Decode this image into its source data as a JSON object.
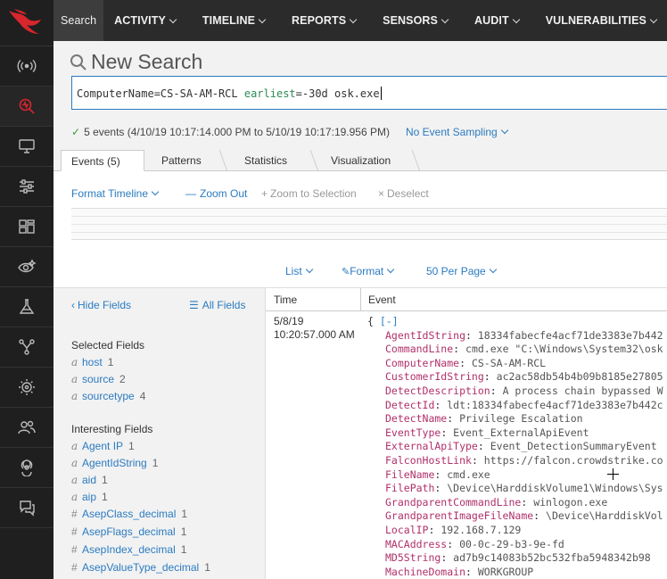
{
  "nav": {
    "items": [
      {
        "label": "Search",
        "dropdown": false
      },
      {
        "label": "ACTIVITY",
        "dropdown": true
      },
      {
        "label": "TIMELINE",
        "dropdown": true
      },
      {
        "label": "REPORTS",
        "dropdown": true
      },
      {
        "label": "SENSORS",
        "dropdown": true
      },
      {
        "label": "AUDIT",
        "dropdown": true
      },
      {
        "label": "VULNERABILITIES",
        "dropdown": true
      }
    ]
  },
  "rail": {
    "icons": [
      "falcon-logo-icon",
      "broadcast-icon",
      "search-activity-icon",
      "monitor-icon",
      "sliders-icon",
      "dashboard-icon",
      "eye-sparkle-icon",
      "flask-icon",
      "network-graph-icon",
      "target-icon",
      "users-icon",
      "biohazard-icon",
      "chat-icon"
    ]
  },
  "header": {
    "title": "New Search",
    "query": {
      "prefix": "ComputerName=CS-SA-AM-RCL ",
      "keyword": "earliest",
      "suffix": "=-30d osk.exe"
    },
    "status_text": "5 events (4/10/19 10:17:14.000 PM to 5/10/19 10:17:19.956 PM)",
    "sampling_label": "No Event Sampling"
  },
  "tabs": [
    "Events (5)",
    "Patterns",
    "Statistics",
    "Visualization"
  ],
  "timeline_toolbar": {
    "format_timeline": "Format Timeline",
    "zoom_out": "Zoom Out",
    "zoom_to_selection": "Zoom to Selection",
    "deselect": "Deselect"
  },
  "list_toolbar": {
    "list": "List",
    "format": "Format",
    "per_page": "50 Per Page"
  },
  "fields": {
    "hide_fields": "Hide Fields",
    "all_fields": "All Fields",
    "selected_heading": "Selected Fields",
    "selected": [
      {
        "type": "a",
        "name": "host",
        "count": "1"
      },
      {
        "type": "a",
        "name": "source",
        "count": "2"
      },
      {
        "type": "a",
        "name": "sourcetype",
        "count": "4"
      }
    ],
    "interesting_heading": "Interesting Fields",
    "interesting": [
      {
        "type": "a",
        "name": "Agent IP",
        "count": "1"
      },
      {
        "type": "a",
        "name": "AgentIdString",
        "count": "1"
      },
      {
        "type": "a",
        "name": "aid",
        "count": "1"
      },
      {
        "type": "a",
        "name": "aip",
        "count": "1"
      },
      {
        "type": "#",
        "name": "AsepClass_decimal",
        "count": "1"
      },
      {
        "type": "#",
        "name": "AsepFlags_decimal",
        "count": "1"
      },
      {
        "type": "#",
        "name": "AsepIndex_decimal",
        "count": "1"
      },
      {
        "type": "#",
        "name": "AsepValueType_decimal",
        "count": "1"
      }
    ]
  },
  "events": {
    "col_time": "Time",
    "col_event": "Event",
    "time_date": "5/8/19",
    "time_clock": "10:20:57.000 AM",
    "open_brace": "{",
    "collapse": "[-]",
    "kv": [
      {
        "k": "AgentIdString",
        "v": "18334fabecfe4acf71de3383e7b442"
      },
      {
        "k": "CommandLine",
        "v": "cmd.exe \"C:\\Windows\\System32\\osk"
      },
      {
        "k": "ComputerName",
        "v": "CS-SA-AM-RCL"
      },
      {
        "k": "CustomerIdString",
        "v": "ac2ac58db54b4b09b8185e27805"
      },
      {
        "k": "DetectDescription",
        "v": "A process chain bypassed W"
      },
      {
        "k": "DetectId",
        "v": "ldt:18334fabecfe4acf71de3383e7b442c"
      },
      {
        "k": "DetectName",
        "v": "Privilege Escalation"
      },
      {
        "k": "EventType",
        "v": "Event_ExternalApiEvent"
      },
      {
        "k": "ExternalApiType",
        "v": "Event_DetectionSummaryEvent"
      },
      {
        "k": "FalconHostLink",
        "v": "https://falcon.crowdstrike.co"
      },
      {
        "k": "FileName",
        "v": "cmd.exe"
      },
      {
        "k": "FilePath",
        "v": "\\Device\\HarddiskVolume1\\Windows\\Sys"
      },
      {
        "k": "GrandparentCommandLine",
        "v": "winlogon.exe"
      },
      {
        "k": "GrandparentImageFileName",
        "v": "\\Device\\HarddiskVol"
      },
      {
        "k": "LocalIP",
        "v": "192.168.7.129"
      },
      {
        "k": "MACAddress",
        "v": "00-0c-29-b3-9e-fd"
      },
      {
        "k": "MD5String",
        "v": "ad7b9c14083b52bc532fba5948342b98"
      },
      {
        "k": "MachineDomain",
        "v": "WORKGROUP"
      }
    ]
  }
}
